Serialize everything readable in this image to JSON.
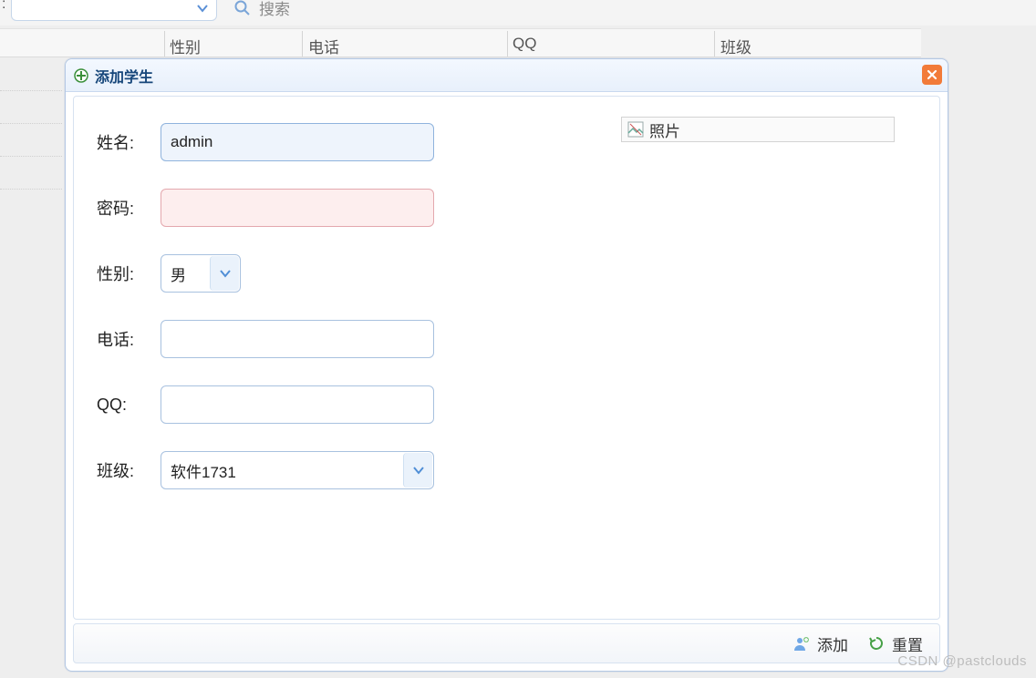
{
  "toolbar": {
    "search_label": "搜索"
  },
  "columns": {
    "gender": "性别",
    "phone": "电话",
    "qq": "QQ",
    "class": "班级"
  },
  "dialog": {
    "title": "添加学生",
    "labels": {
      "name": "姓名:",
      "password": "密码:",
      "gender": "性别:",
      "phone": "电话:",
      "qq": "QQ:",
      "class": "班级:"
    },
    "values": {
      "name": "admin",
      "password": "",
      "gender": "男",
      "phone": "",
      "qq": "",
      "class": "软件1731"
    },
    "photo_label": "照片",
    "buttons": {
      "add": "添加",
      "reset": "重置"
    }
  },
  "watermark": "CSDN @pastclouds"
}
